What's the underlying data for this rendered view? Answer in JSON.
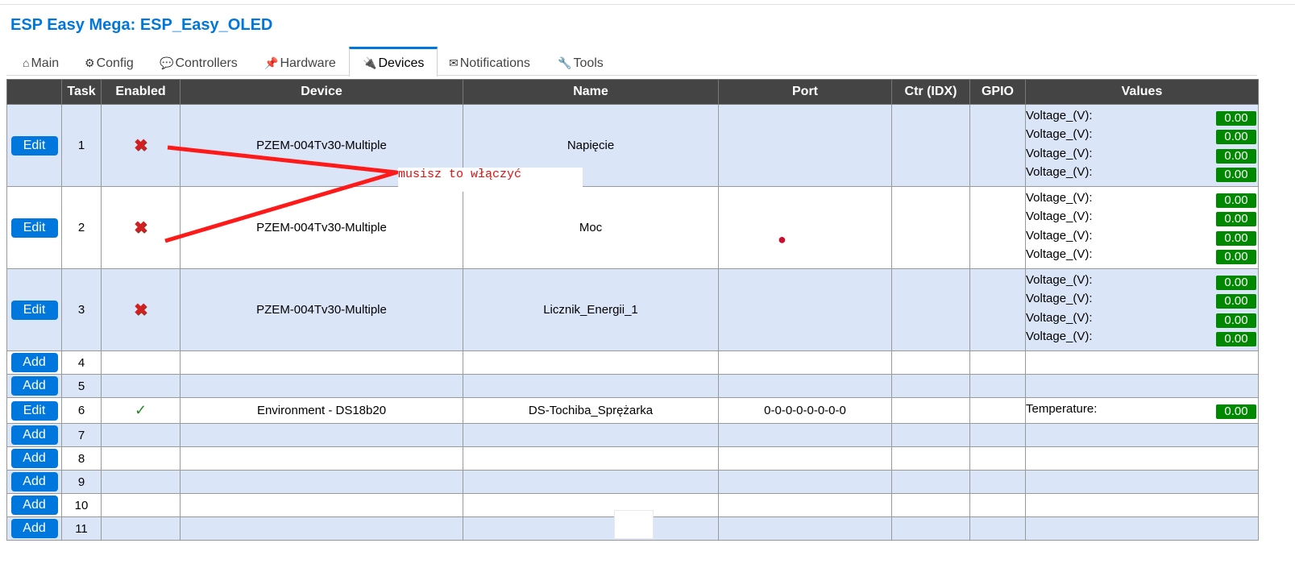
{
  "app": {
    "title": "ESP Easy Mega: ESP_Easy_OLED"
  },
  "tabs": [
    {
      "icon": "⌂",
      "label": "Main"
    },
    {
      "icon": "⚙",
      "label": "Config"
    },
    {
      "icon": "💬",
      "label": "Controllers"
    },
    {
      "icon": "📌",
      "label": "Hardware"
    },
    {
      "icon": "🔌",
      "label": "Devices"
    },
    {
      "icon": "✉",
      "label": "Notifications"
    },
    {
      "icon": "🔧",
      "label": "Tools"
    }
  ],
  "table": {
    "headers": [
      "",
      "Task",
      "Enabled",
      "Device",
      "Name",
      "Port",
      "Ctr (IDX)",
      "GPIO",
      "Values"
    ],
    "rows": [
      {
        "button": "Edit",
        "task": "1",
        "enabled": "✖",
        "device": "PZEM-004Tv30-Multiple",
        "name": "Napięcie",
        "port": "",
        "ctr": "",
        "gpio": "",
        "values": [
          {
            "label": "Voltage_(V):",
            "value": "0.00"
          },
          {
            "label": "Voltage_(V):",
            "value": "0.00"
          },
          {
            "label": "Voltage_(V):",
            "value": "0.00"
          },
          {
            "label": "Voltage_(V):",
            "value": "0.00"
          }
        ]
      },
      {
        "button": "Edit",
        "task": "2",
        "enabled": "✖",
        "device": "PZEM-004Tv30-Multiple",
        "name": "Moc",
        "port": "",
        "ctr": "",
        "gpio": "",
        "values": [
          {
            "label": "Voltage_(V):",
            "value": "0.00"
          },
          {
            "label": "Voltage_(V):",
            "value": "0.00"
          },
          {
            "label": "Voltage_(V):",
            "value": "0.00"
          },
          {
            "label": "Voltage_(V):",
            "value": "0.00"
          }
        ]
      },
      {
        "button": "Edit",
        "task": "3",
        "enabled": "✖",
        "device": "PZEM-004Tv30-Multiple",
        "name": "Licznik_Energii_1",
        "port": "",
        "ctr": "",
        "gpio": "",
        "values": [
          {
            "label": "Voltage_(V):",
            "value": "0.00"
          },
          {
            "label": "Voltage_(V):",
            "value": "0.00"
          },
          {
            "label": "Voltage_(V):",
            "value": "0.00"
          },
          {
            "label": "Voltage_(V):",
            "value": "0.00"
          }
        ]
      },
      {
        "button": "Add",
        "task": "4"
      },
      {
        "button": "Add",
        "task": "5"
      },
      {
        "button": "Edit",
        "task": "6",
        "enabled": "✓",
        "device": "Environment - DS18b20",
        "name": "DS-Tochiba_Sprężarka",
        "port": "0-0-0-0-0-0-0-0",
        "ctr": "",
        "gpio": "",
        "values": [
          {
            "label": "Temperature:",
            "value": "0.00"
          }
        ]
      },
      {
        "button": "Add",
        "task": "7"
      },
      {
        "button": "Add",
        "task": "8"
      },
      {
        "button": "Add",
        "task": "9"
      },
      {
        "button": "Add",
        "task": "10"
      },
      {
        "button": "Add",
        "task": "11"
      }
    ]
  },
  "annotation": {
    "text": "musisz to włączyć",
    "color": "#e01010"
  },
  "colors": {
    "accent": "#0077dd",
    "header_bg": "#444444",
    "row_alt": "#dbe5f8",
    "value_badge": "#008800",
    "disabled_x": "#d21f1f",
    "enabled_check": "#2a8a2a"
  }
}
